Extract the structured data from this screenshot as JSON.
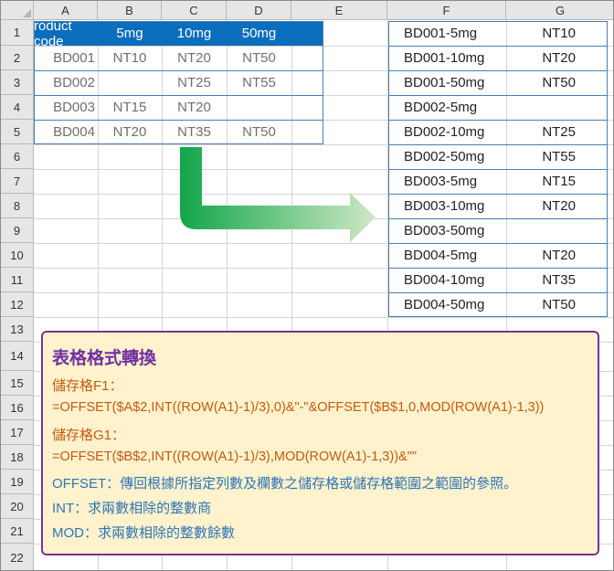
{
  "columns": [
    "A",
    "B",
    "C",
    "D",
    "E",
    "F",
    "G"
  ],
  "rows": [
    "1",
    "2",
    "3",
    "4",
    "5",
    "6",
    "7",
    "8",
    "9",
    "10",
    "11",
    "12",
    "13",
    "14",
    "15",
    "16",
    "17",
    "18",
    "19",
    "20",
    "21",
    "22"
  ],
  "source_table": {
    "headers": [
      "roduct code",
      "5mg",
      "10mg",
      "50mg"
    ],
    "rows": [
      [
        "BD001",
        "NT10",
        "NT20",
        "NT50"
      ],
      [
        "BD002",
        "",
        "NT25",
        "NT55"
      ],
      [
        "BD003",
        "NT15",
        "NT20",
        ""
      ],
      [
        "BD004",
        "NT20",
        "NT35",
        "NT50"
      ]
    ]
  },
  "output_table": {
    "rows": [
      [
        "BD001-5mg",
        "NT10"
      ],
      [
        "BD001-10mg",
        "NT20"
      ],
      [
        "BD001-50mg",
        "NT50"
      ],
      [
        "BD002-5mg",
        ""
      ],
      [
        "BD002-10mg",
        "NT25"
      ],
      [
        "BD002-50mg",
        "NT55"
      ],
      [
        "BD003-5mg",
        "NT15"
      ],
      [
        "BD003-10mg",
        "NT20"
      ],
      [
        "BD003-50mg",
        ""
      ],
      [
        "BD004-5mg",
        "NT20"
      ],
      [
        "BD004-10mg",
        "NT35"
      ],
      [
        "BD004-50mg",
        "NT50"
      ]
    ]
  },
  "info": {
    "title": "表格格式轉換",
    "f1_label": "儲存格F1：",
    "f1_formula": "=OFFSET($A$2,INT((ROW(A1)-1)/3),0)&\"-\"&OFFSET($B$1,0,MOD(ROW(A1)-1,3))",
    "g1_label": "儲存格G1：",
    "g1_formula": "=OFFSET($B$2,INT((ROW(A1)-1)/3),MOD(ROW(A1)-1,3))&\"\"",
    "offset_desc": "OFFSET：傳回根據所指定列數及欄數之儲存格或儲存格範圍之範圍的參照。",
    "int_desc": "INT：求兩數相除的整數商",
    "mod_desc": "MOD：求兩數相除的整數餘數"
  },
  "colors": {
    "header_fill": "#0a6ebd",
    "arrow_start": "#12a64a",
    "arrow_end": "#cfe8c6",
    "info_fill": "#fff2cc",
    "info_border": "#7b2f9e"
  }
}
